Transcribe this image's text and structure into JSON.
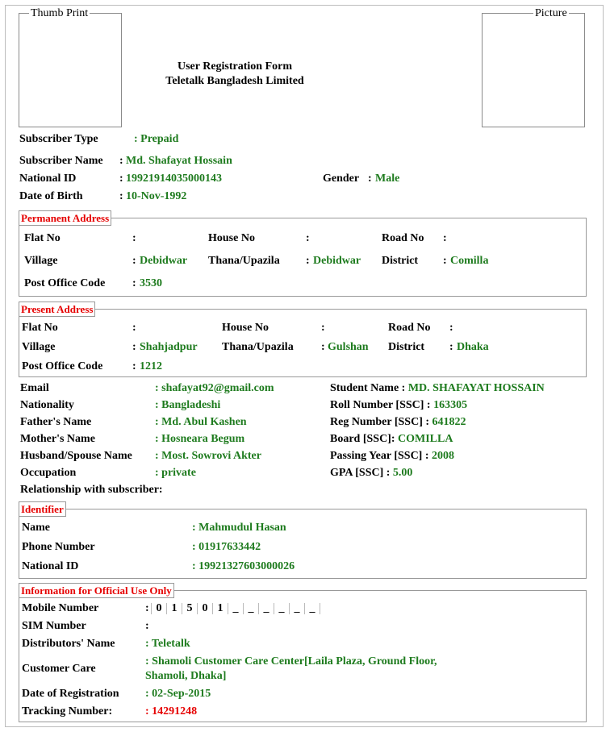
{
  "header": {
    "thumb_label": "Thumb Print",
    "picture_label": "Picture",
    "title_line1": "User Registration Form",
    "title_line2": "Teletalk Bangladesh Limited"
  },
  "subscriber": {
    "type_label": "Subscriber Type",
    "type_value": ": Prepaid",
    "name_label": "Subscriber Name",
    "name_sep": ":",
    "name_value": "Md. Shafayat Hossain",
    "nid_label": "National ID",
    "nid_sep": ":",
    "nid_value": "19921914035000143",
    "gender_label": "Gender",
    "gender_sep": ":",
    "gender_value": "Male",
    "dob_label": "Date of Birth",
    "dob_sep": ":",
    "dob_value": "10-Nov-1992"
  },
  "permanent_address": {
    "legend": "Permanent Address",
    "flat_label": "Flat No",
    "flat_sep": ":",
    "house_label": "House No",
    "house_sep": ":",
    "road_label": "Road No",
    "road_sep": ":",
    "village_label": "Village",
    "village_sep": ":",
    "village_value": "Debidwar",
    "thana_label": "Thana/Upazila",
    "thana_sep": ":",
    "thana_value": "Debidwar",
    "district_label": "District",
    "district_sep": ":",
    "district_value": "Comilla",
    "po_label": "Post Office Code",
    "po_sep": ":",
    "po_value": "3530"
  },
  "present_address": {
    "legend": "Present Address",
    "flat_label": "Flat No",
    "flat_sep": ":",
    "house_label": "House No",
    "house_sep": ":",
    "road_label": "Road No",
    "road_sep": ":",
    "village_label": "Village",
    "village_sep": ":",
    "village_value": "Shahjadpur",
    "thana_label": "Thana/Upazila",
    "thana_sep": ":",
    "thana_value": "Gulshan",
    "district_label": "District",
    "district_sep": ":",
    "district_value": "Dhaka",
    "po_label": "Post Office Code",
    "po_sep": ":",
    "po_value": "1212"
  },
  "personal": {
    "email_label": "Email",
    "email_value": ": shafayat92@gmail.com",
    "nationality_label": "Nationality",
    "nationality_value": ": Bangladeshi",
    "father_label": "Father's Name",
    "father_value": ": Md. Abul Kashen",
    "mother_label": "Mother's Name",
    "mother_value": ": Hosneara Begum",
    "spouse_label": "Husband/Spouse Name",
    "spouse_value": ": Most. Sowrovi Akter",
    "occupation_label": "Occupation",
    "occupation_value": ": private",
    "relationship_label": "Relationship with subscriber:"
  },
  "education": {
    "student_label": "Student Name",
    "student_sep": ":",
    "student_value": "MD. SHAFAYAT HOSSAIN",
    "roll_label": "Roll Number [SSC]",
    "roll_sep": ":",
    "roll_value": "163305",
    "reg_label": "Reg Number [SSC]",
    "reg_sep": ":",
    "reg_value": "641822",
    "board_label": "Board [SSC]:",
    "board_value": "COMILLA",
    "year_label": "Passing Year [SSC]",
    "year_sep": ":",
    "year_value": "2008",
    "gpa_label": "GPA [SSC]",
    "gpa_sep": ":",
    "gpa_value": "5.00"
  },
  "identifier": {
    "legend": "Identifier",
    "name_label": "Name",
    "name_value": ": Mahmudul Hasan",
    "phone_label": "Phone Number",
    "phone_value": ": 01917633442",
    "nid_label": "National ID",
    "nid_value": ": 19921327603000026"
  },
  "official": {
    "legend": "Information for Official Use Only",
    "mobile_label": "Mobile Number",
    "mobile_sep": ":",
    "mobile_digits": [
      "0",
      "1",
      "5",
      "0",
      "1",
      "_",
      "_",
      "_",
      "_",
      "_",
      "_"
    ],
    "sim_label": "SIM Number",
    "sim_sep": ":",
    "distributor_label": "Distributors' Name",
    "distributor_value": ": Teletalk",
    "care_label": "Customer Care",
    "care_value_line1": ": Shamoli Customer Care Center[Laila Plaza, Ground Floor,",
    "care_value_line2": "Shamoli, Dhaka]",
    "regdate_label": "Date of Registration",
    "regdate_value": ": 02-Sep-2015",
    "tracking_label": "Tracking Number:",
    "tracking_value": ": 14291248"
  },
  "colors": {
    "value_green": "#1e7b1e",
    "legend_red": "#e60000"
  }
}
